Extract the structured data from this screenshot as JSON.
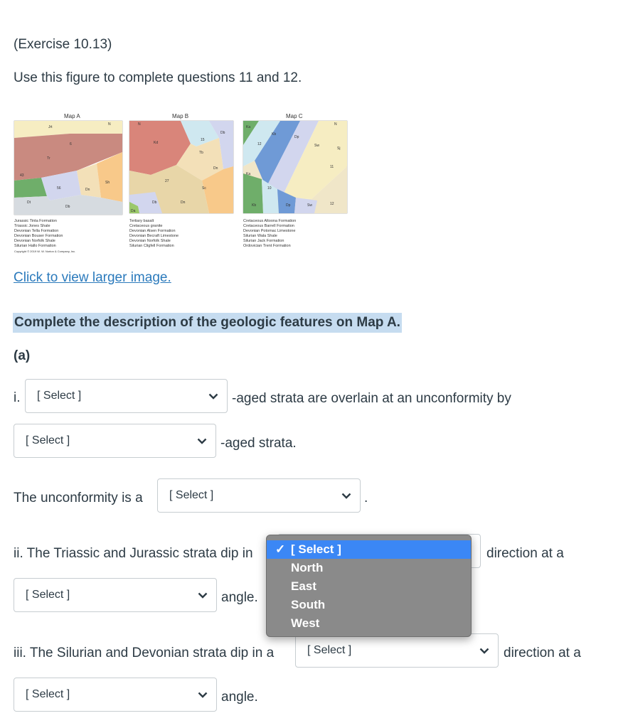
{
  "exercise_label": "(Exercise 10.13)",
  "instruction": "Use this figure to complete questions 11 and 12.",
  "figure": {
    "map_titles": [
      "Map A",
      "Map B",
      "Map C"
    ],
    "legend_a": [
      "Jurassic Tinta Formation",
      "Triassic Jones Shale",
      "Devonian Tella Formation",
      "Devonian Bouser Formation",
      "Devonian Norfolk Shale",
      "Silurian Hallo Formation"
    ],
    "legend_b": [
      "Tertiary basalt",
      "Cretaceous granite",
      "Devonian Alsen Formation",
      "Devonian Becraft Limestone",
      "Devonian Norfolk Shale",
      "Silurian Cligfell Formation"
    ],
    "legend_c": [
      "Cretaceous Altoona Formation",
      "Cretaceous Barrell Formation",
      "Devonian Potomac Limestone",
      "Silurian Wala Shale",
      "Silurian Jack Formation",
      "Ordovician Trent Formation"
    ],
    "copyright": "Copyright © 2019 W. W. Norton & Company, Inc.",
    "map_a_labels": [
      "Jrt",
      "Tr",
      "6",
      "43",
      "56",
      "Dn",
      "Sh",
      "Dt",
      "Db",
      "N"
    ],
    "map_b_labels": [
      "Kd",
      "15",
      "Db",
      "Tb",
      "Dn",
      "27",
      "Sc",
      "Db",
      "Dn",
      "Da",
      "N"
    ],
    "map_c_labels": [
      "Ka",
      "Kb",
      "Dp",
      "Sw",
      "Sj",
      "12",
      "11",
      "Ka",
      "10",
      "Kb",
      "Dp",
      "Sw",
      "12",
      "N"
    ]
  },
  "view_link": "Click to view larger image.",
  "section_heading": "Complete the description of the geologic features on Map A.",
  "part_label": "(a)",
  "q1": {
    "marker": "i.",
    "select1": "[ Select ]",
    "text1": "-aged strata are overlain at an unconformity by",
    "select2": "[ Select ]",
    "text2": "-aged strata.",
    "text3": "The unconformity is a",
    "select3": "[ Select ]",
    "text3_end": "."
  },
  "q2": {
    "text1": "ii. The Triassic and Jurassic strata dip in",
    "text2": "direction at a",
    "select_angle": "[ Select ]",
    "text3": "angle."
  },
  "dropdown": {
    "options": [
      "[ Select ]",
      "North",
      "East",
      "South",
      "West"
    ],
    "check": "✓"
  },
  "q3": {
    "text1": "iii. The Silurian and Devonian strata dip in a",
    "select_dir": "[ Select ]",
    "text2": "direction at a",
    "select_angle": "[ Select ]",
    "text3": "angle."
  }
}
